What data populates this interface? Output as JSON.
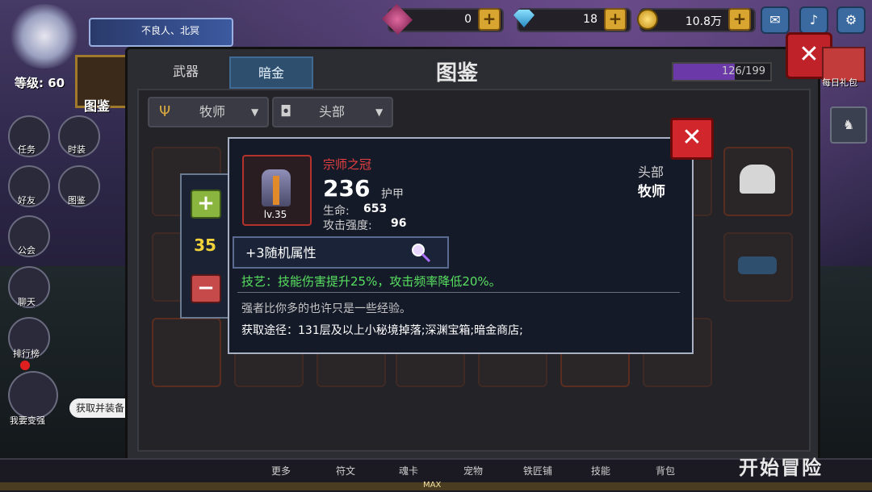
{
  "hud": {
    "guild_name": "不良人、北冥",
    "level_label": "等级: 60",
    "codex_label": "图鉴",
    "currency": {
      "gems": "0",
      "diamonds": "18",
      "gold": "10.8万"
    },
    "daily_gift_label": "每日礼包"
  },
  "sidebar": {
    "items": [
      {
        "label": "任务"
      },
      {
        "label": "时装"
      },
      {
        "label": "好友"
      },
      {
        "label": "图鉴"
      },
      {
        "label": "公会"
      },
      {
        "label": "聊天"
      },
      {
        "label": "排行榜"
      },
      {
        "label": "我要变强"
      }
    ],
    "chat_bubble": "获取并装备"
  },
  "codex": {
    "title": "图鉴",
    "tabs": [
      {
        "label": "武器"
      },
      {
        "label": "暗金"
      }
    ],
    "progress_text": "126/199",
    "progress_fraction": 0.633,
    "filters": {
      "class": "牧师",
      "slot": "头部"
    }
  },
  "popup": {
    "item_name": "宗师之冠",
    "item_level": "lv.35",
    "score": "236",
    "score_label": "护甲",
    "stats": [
      {
        "label": "生命:",
        "value": "653"
      },
      {
        "label": "攻击强度:",
        "value": "96"
      }
    ],
    "slot_type": "头部",
    "class_type": "牧师",
    "random_attr": "+3随机属性",
    "skill": "技艺：技能伤害提升25%，攻击频率降低20%。",
    "flavor": "强者比你多的也许只是一些经验。",
    "source": "获取途径：131层及以上小秘境掉落;深渊宝箱;暗金商店;",
    "quantity": "35"
  },
  "bottom_nav": {
    "items": [
      "更多",
      "符文",
      "魂卡",
      "宠物",
      "铁匠铺",
      "技能",
      "背包"
    ],
    "max_label": "MAX",
    "adventure_label": "开始冒险"
  },
  "colors": {
    "accent_red": "#d0262c",
    "item_name_red": "#e84040",
    "skill_green": "#58e060",
    "quantity_yellow": "#f2d23a",
    "progress_purple": "#6b3aa8"
  }
}
